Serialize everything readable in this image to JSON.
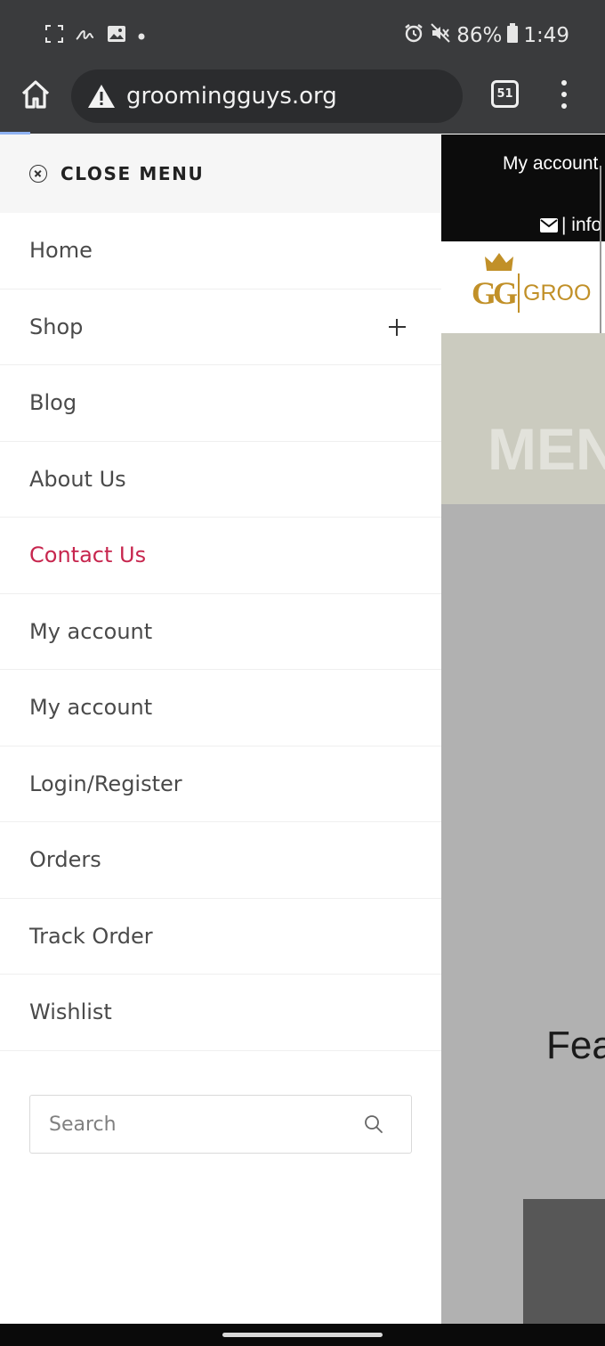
{
  "status_bar": {
    "battery": "86%",
    "time": "1:49",
    "icons": [
      "screenshot-icon",
      "signature-icon",
      "image-icon",
      "dot-icon",
      "alarm-icon",
      "mute-icon",
      "battery-icon"
    ]
  },
  "browser": {
    "url": "groomingguys.org",
    "tab_count": "51",
    "icons": [
      "home-icon",
      "warning-icon",
      "tabs-icon",
      "more-vert-icon"
    ]
  },
  "drawer": {
    "close_label": "CLOSE MENU",
    "items": [
      {
        "label": "Home"
      },
      {
        "label": "Shop",
        "expandable": true
      },
      {
        "label": "Blog"
      },
      {
        "label": "About Us"
      },
      {
        "label": "Contact Us",
        "active": true
      },
      {
        "label": "My account"
      },
      {
        "label": "My account"
      },
      {
        "label": "Login/Register"
      },
      {
        "label": "Orders"
      },
      {
        "label": "Track Order"
      },
      {
        "label": "Wishlist"
      }
    ],
    "search_placeholder": "Search",
    "active_color": "#c7264e"
  },
  "background_page": {
    "top_link": "My account",
    "info_text": "| info",
    "logo_mark": "GG",
    "logo_text": "GROO",
    "hero_text": "MEN",
    "featured_text": "Fea",
    "brand_color": "#c19028"
  }
}
